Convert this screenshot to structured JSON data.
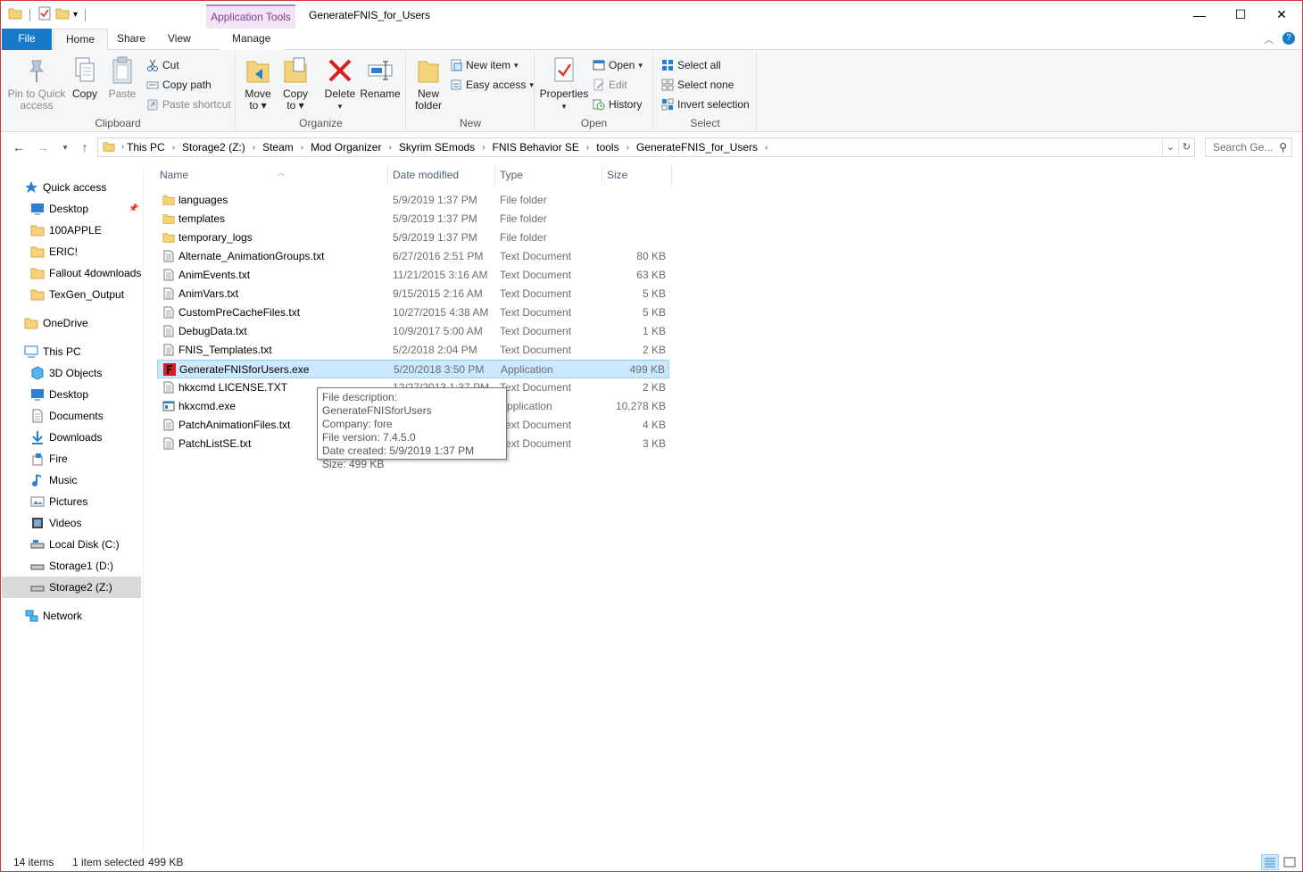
{
  "window": {
    "title": "GenerateFNIS_for_Users",
    "context_tab_group": "Application Tools",
    "controls": {
      "minimize": "—",
      "maximize": "☐",
      "close": "✕"
    }
  },
  "tabs": [
    {
      "label": "File"
    },
    {
      "label": "Home"
    },
    {
      "label": "Share"
    },
    {
      "label": "View"
    },
    {
      "label": "Manage"
    }
  ],
  "ribbon": {
    "clipboard": {
      "label": "Clipboard",
      "pin": "Pin to Quick access",
      "copy": "Copy",
      "paste": "Paste",
      "cut": "Cut",
      "copy_path": "Copy path",
      "paste_shortcut": "Paste shortcut"
    },
    "organize": {
      "label": "Organize",
      "move_to": "Move to",
      "copy_to": "Copy to",
      "delete": "Delete",
      "rename": "Rename"
    },
    "new": {
      "label": "New",
      "new_folder": "New folder",
      "new_item": "New item",
      "easy_access": "Easy access"
    },
    "open": {
      "label": "Open",
      "properties": "Properties",
      "open": "Open",
      "edit": "Edit",
      "history": "History"
    },
    "select": {
      "label": "Select",
      "select_all": "Select all",
      "select_none": "Select none",
      "invert_selection": "Invert selection"
    }
  },
  "address": {
    "crumbs": [
      "This PC",
      "Storage2 (Z:)",
      "Steam",
      "Mod Organizer",
      "Skyrim SEmods",
      "FNIS Behavior SE",
      "tools",
      "GenerateFNIS_for_Users"
    ],
    "search_placeholder": "Search Ge..."
  },
  "sidebar": {
    "quick_access": "Quick access",
    "quick_items": [
      "Desktop",
      "100APPLE",
      "ERIC!",
      "Fallout 4downloads",
      "TexGen_Output"
    ],
    "onedrive": "OneDrive",
    "this_pc": "This PC",
    "pc_items": [
      "3D Objects",
      "Desktop",
      "Documents",
      "Downloads",
      "Fire",
      "Music",
      "Pictures",
      "Videos",
      "Local Disk (C:)",
      "Storage1 (D:)",
      "Storage2 (Z:)"
    ],
    "network": "Network"
  },
  "columns": {
    "name": "Name",
    "date": "Date modified",
    "type": "Type",
    "size": "Size"
  },
  "files": [
    {
      "name": "languages",
      "date": "5/9/2019 1:37 PM",
      "type": "File folder",
      "size": "",
      "kind": "folder"
    },
    {
      "name": "templates",
      "date": "5/9/2019 1:37 PM",
      "type": "File folder",
      "size": "",
      "kind": "folder"
    },
    {
      "name": "temporary_logs",
      "date": "5/9/2019 1:37 PM",
      "type": "File folder",
      "size": "",
      "kind": "folder"
    },
    {
      "name": "Alternate_AnimationGroups.txt",
      "date": "6/27/2016 2:51 PM",
      "type": "Text Document",
      "size": "80 KB",
      "kind": "txt"
    },
    {
      "name": "AnimEvents.txt",
      "date": "11/21/2015 3:16 AM",
      "type": "Text Document",
      "size": "63 KB",
      "kind": "txt"
    },
    {
      "name": "AnimVars.txt",
      "date": "9/15/2015 2:16 AM",
      "type": "Text Document",
      "size": "5 KB",
      "kind": "txt"
    },
    {
      "name": "CustomPreCacheFiles.txt",
      "date": "10/27/2015 4:38 AM",
      "type": "Text Document",
      "size": "5 KB",
      "kind": "txt"
    },
    {
      "name": "DebugData.txt",
      "date": "10/9/2017 5:00 AM",
      "type": "Text Document",
      "size": "1 KB",
      "kind": "txt"
    },
    {
      "name": "FNIS_Templates.txt",
      "date": "5/2/2018 2:04 PM",
      "type": "Text Document",
      "size": "2 KB",
      "kind": "txt"
    },
    {
      "name": "GenerateFNISforUsers.exe",
      "date": "5/20/2018 3:50 PM",
      "type": "Application",
      "size": "499 KB",
      "kind": "fnis"
    },
    {
      "name": "hkxcmd LICENSE.TXT",
      "date": "12/27/2013 1:37 PM",
      "type": "Text Document",
      "size": "2 KB",
      "kind": "txt"
    },
    {
      "name": "hkxcmd.exe",
      "date": "",
      "type": "Application",
      "size": "10,278 KB",
      "kind": "exe"
    },
    {
      "name": "PatchAnimationFiles.txt",
      "date": "",
      "type": "Text Document",
      "size": "4 KB",
      "kind": "txt"
    },
    {
      "name": "PatchListSE.txt",
      "date": "",
      "type": "Text Document",
      "size": "3 KB",
      "kind": "txt"
    }
  ],
  "selected_index": 9,
  "tooltip": {
    "lines": [
      "File description: GenerateFNISforUsers",
      "Company: fore",
      "File version: 7.4.5.0",
      "Date created: 5/9/2019 1:37 PM",
      "Size: 499 KB"
    ]
  },
  "status": {
    "items": "14 items",
    "selected": "1 item selected",
    "size": "499 KB"
  },
  "colors": {
    "accent": "#1979ca",
    "selection_bg": "#cce8ff",
    "selection_border": "#99d1ff",
    "window_border": "#cc3b3b",
    "context_tab": "#f2e3f5"
  }
}
